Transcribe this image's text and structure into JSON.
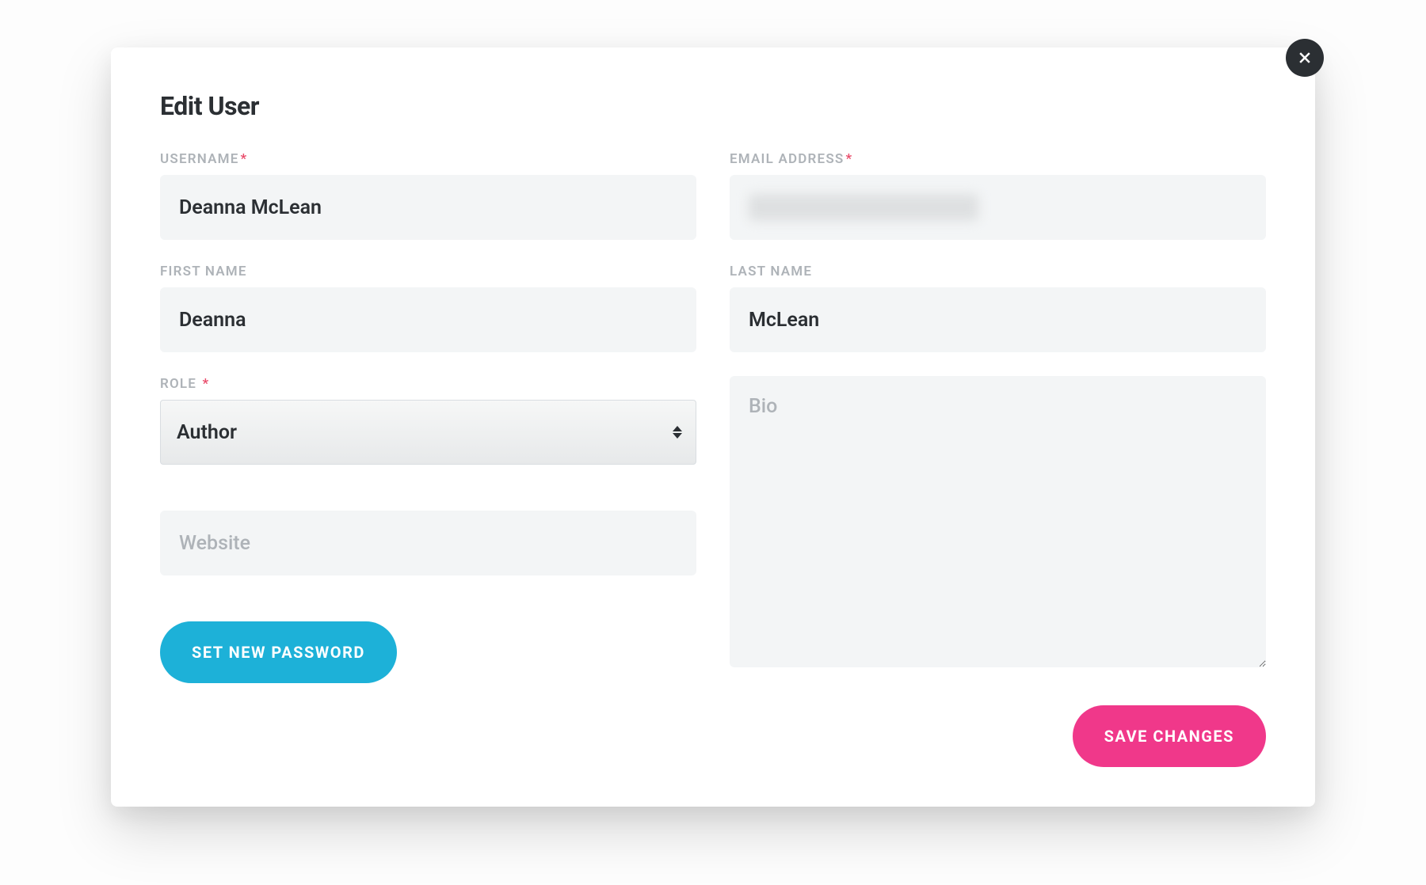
{
  "modal": {
    "title": "Edit User",
    "required_marker": "*"
  },
  "labels": {
    "username": "USERNAME",
    "email": "EMAIL ADDRESS",
    "first_name": "FIRST NAME",
    "last_name": "LAST NAME",
    "role": "ROLE"
  },
  "values": {
    "username": "Deanna McLean",
    "email": "",
    "first_name": "Deanna",
    "last_name": "McLean",
    "role": "Author",
    "website": "",
    "bio": ""
  },
  "placeholders": {
    "website": "Website",
    "bio": "Bio"
  },
  "buttons": {
    "set_password": "SET NEW PASSWORD",
    "save": "SAVE CHANGES"
  }
}
